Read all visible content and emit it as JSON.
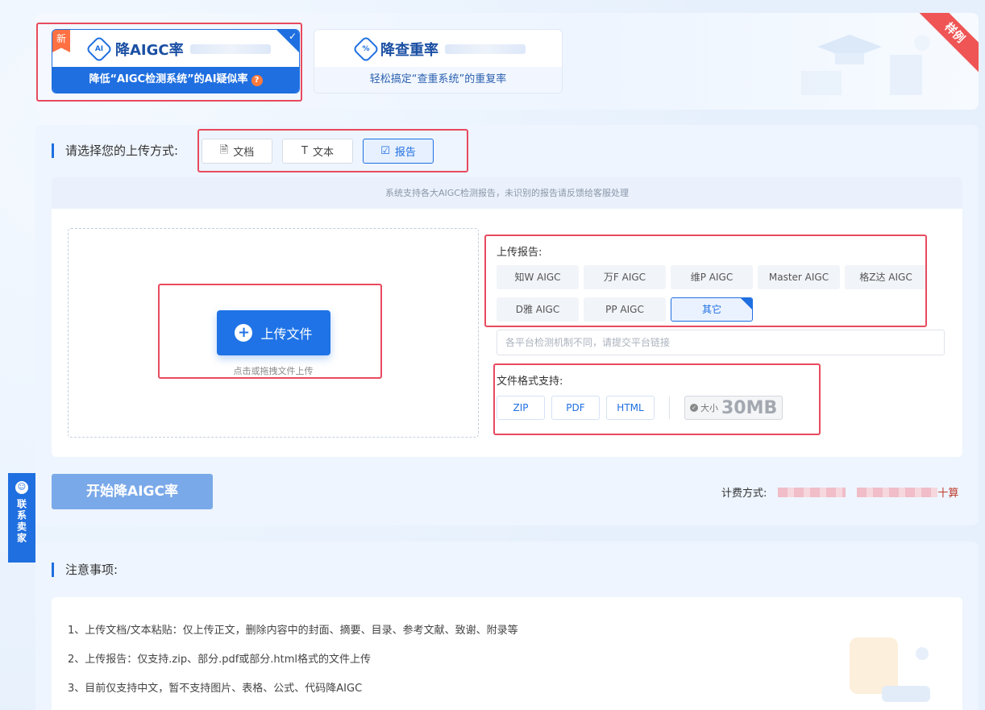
{
  "top": {
    "sample_ribbon": "样例",
    "mode_active": {
      "new_tag": "新",
      "logo": "AI",
      "title": "降AIGC率",
      "subtitle": "降低“AIGC检测系统”的AI疑似率",
      "help": "?"
    },
    "mode_inactive": {
      "logo": "%",
      "title": "降查重率",
      "subtitle": "轻松搞定“查重系统”的重复率"
    }
  },
  "upload": {
    "label": "请选择您的上传方式:",
    "tabs": [
      {
        "label": "文档",
        "icon": "document-icon"
      },
      {
        "label": "文本",
        "icon": "text-icon"
      },
      {
        "label": "报告",
        "icon": "report-icon",
        "active": true
      }
    ],
    "notice": "系统支持各大AIGC检测报告，未识别的报告请反馈给客服处理",
    "button_label": "上传文件",
    "drop_hint": "点击或拖拽文件上传"
  },
  "report": {
    "title": "上传报告:",
    "platforms": [
      "知W AIGC",
      "万F AIGC",
      "维P AIGC",
      "Master AIGC",
      "格Z达 AIGC",
      "D雅 AIGC",
      "PP AIGC",
      "其它"
    ],
    "selected": "其它",
    "input_placeholder": "各平台检测机制不同，请提交平台链接",
    "format_title": "文件格式支持:",
    "formats": [
      "ZIP",
      "PDF",
      "HTML"
    ],
    "size_label": "大小",
    "size_value": "30MB"
  },
  "actions": {
    "start_button": "开始降AIGC率",
    "billing_label": "计费方式:",
    "billing_tail": "十算"
  },
  "notes": {
    "title": "注意事项:",
    "items": [
      "1、上传文档/文本粘贴：仅上传正文，删除内容中的封面、摘要、目录、参考文献、致谢、附录等",
      "2、上传报告：仅支持.zip、部分.pdf或部分.html格式的文件上传",
      "3、目前仅支持中文，暂不支持图片、表格、公式、代码降AIGC"
    ]
  },
  "side": {
    "contact": "联系卖家"
  },
  "colors": {
    "accent": "#1f6fe0",
    "highlight_border": "#e84a5f",
    "ribbon": "#ef5555"
  }
}
